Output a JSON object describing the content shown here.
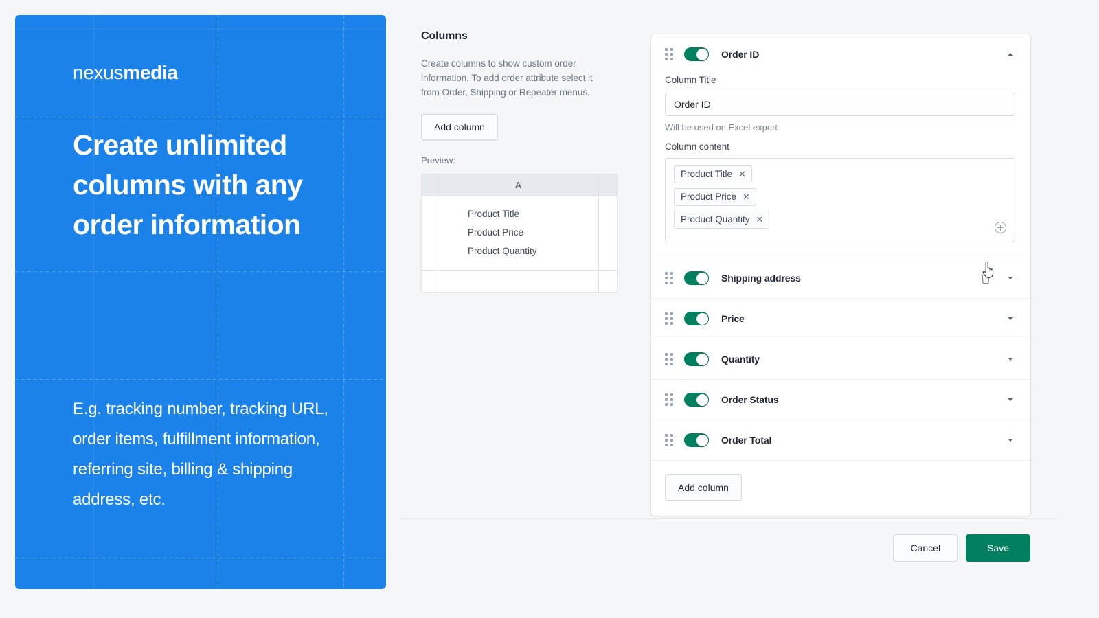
{
  "promo": {
    "brand_thin": "nexus",
    "brand_bold": "media",
    "headline": "Create unlimited columns with any order information",
    "subtext": "E.g. tracking number, tracking URL, order items, fulfillment information, referring site, billing & shipping address, etc.",
    "bg_color": "#1a82e8"
  },
  "columns_section": {
    "title": "Columns",
    "description": "Create columns to show custom order information. To add order attribute select it from Order, Shipping or Repeater menus.",
    "add_column_label": "Add column",
    "preview_label": "Preview:",
    "preview": {
      "column_header": "A",
      "cells": [
        "Product Title",
        "Product Price",
        "Product Quantity"
      ]
    }
  },
  "column_list": {
    "items": [
      {
        "label": "Order ID",
        "enabled": true,
        "expanded": true,
        "chevron": "chevron-up",
        "show_trash": false,
        "column_title_label": "Column Title",
        "column_title_value": "Order ID",
        "column_title_placeholder": "Column Title",
        "hint": "Will be used on Excel export",
        "column_content_label": "Column content",
        "tags": [
          "Product Title",
          "Product Price",
          "Product Quantity"
        ],
        "tag_remove_glyph": "✕",
        "add_content_icon": "plus-circle-icon"
      },
      {
        "label": "Shipping address",
        "enabled": true,
        "expanded": false,
        "chevron": "chevron-down",
        "show_trash": true
      },
      {
        "label": "Price",
        "enabled": true,
        "expanded": false,
        "chevron": "chevron-down",
        "show_trash": false
      },
      {
        "label": "Quantity",
        "enabled": true,
        "expanded": false,
        "chevron": "chevron-down",
        "show_trash": false
      },
      {
        "label": "Order Status",
        "enabled": true,
        "expanded": false,
        "chevron": "chevron-down",
        "show_trash": false
      },
      {
        "label": "Order Total",
        "enabled": true,
        "expanded": false,
        "chevron": "chevron-down",
        "show_trash": false
      }
    ],
    "add_column_label": "Add column",
    "toggle_on_color": "#00805f"
  },
  "footer": {
    "cancel_label": "Cancel",
    "save_label": "Save",
    "save_color": "#00805f"
  }
}
